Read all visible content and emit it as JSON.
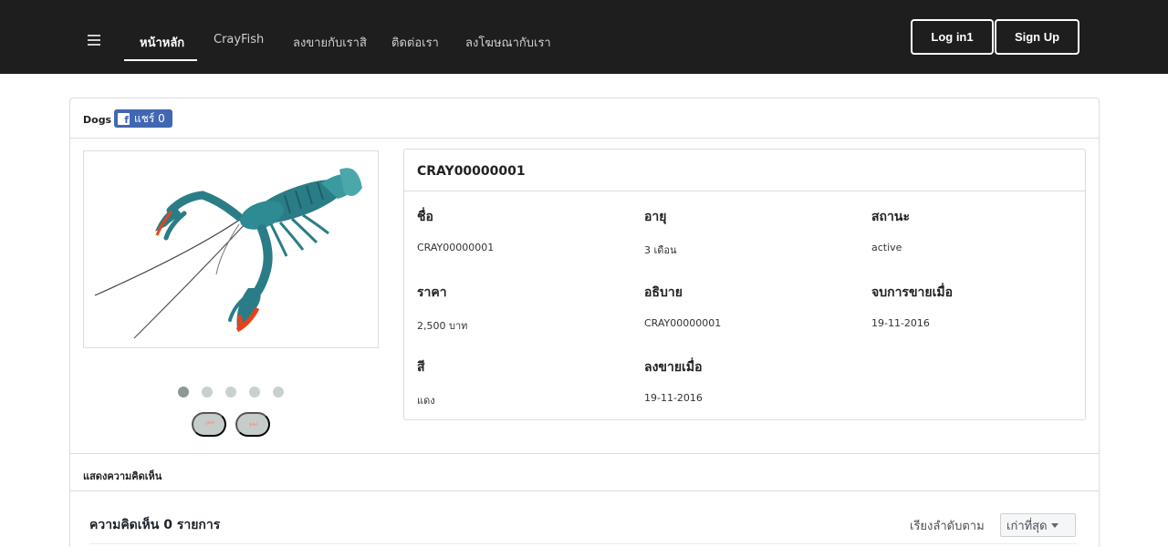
{
  "nav": {
    "links": [
      "หน้าหลัก",
      "CrayFish",
      "ลงขายกับเราสิ",
      "ติดต่อเรา",
      "ลงโฆษณากับเรา"
    ],
    "login_label": "Log in1",
    "signup_label": "Sign Up"
  },
  "panel": {
    "title": "Dogs",
    "share_label": "แชร์ 0"
  },
  "gallery": {
    "image_alt": "crayfish-photo",
    "dot_count": 5,
    "active_dot": 1,
    "prev_icon": "⏮",
    "next_icon": "⏭"
  },
  "detail": {
    "title": "CRAY00000001",
    "fields": [
      {
        "label": "ชื่อ",
        "value": "CRAY00000001"
      },
      {
        "label": "อายุ",
        "value": "3 เดือน"
      },
      {
        "label": "สถานะ",
        "value": "active"
      },
      {
        "label": "ราคา",
        "value": "2,500 บาท"
      },
      {
        "label": "อธิบาย",
        "value": "CRAY00000001"
      },
      {
        "label": "จบการขายเมื่อ",
        "value": "19-11-2016"
      },
      {
        "label": "สี",
        "value": "แดง"
      },
      {
        "label": "ลงขายเมื่อ",
        "value": "19-11-2016"
      }
    ]
  },
  "comments": {
    "section_label": "แสดงความคิดเห็น",
    "count_label": "ความคิดเห็น 0 รายการ",
    "sort_label": "เรียงลำดับตาม",
    "sort_value": "เก่าที่สุด"
  },
  "colors": {
    "navbar": "#1e1e1f",
    "facebook": "#4267b2",
    "crayfish_body": "#2a7d86",
    "crayfish_claw": "#e8421c"
  }
}
